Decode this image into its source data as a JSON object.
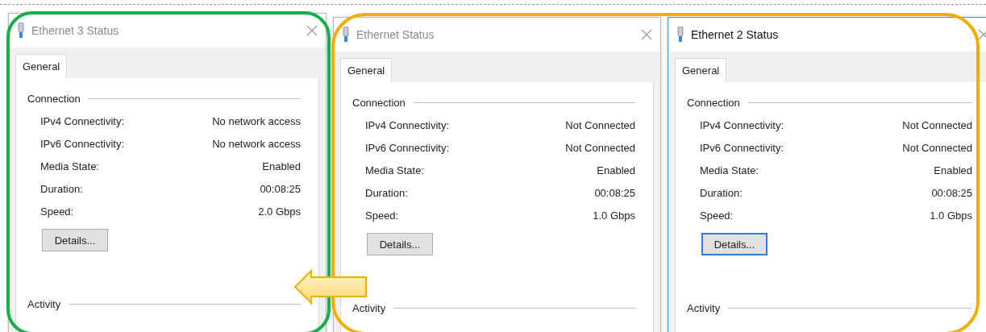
{
  "windows": [
    {
      "title": "Ethernet 3 Status",
      "active": false,
      "tabs": [
        {
          "label": "General",
          "selected": true
        }
      ],
      "section": "Connection",
      "rows": [
        {
          "label": "IPv4 Connectivity:",
          "value": "No network access"
        },
        {
          "label": "IPv6 Connectivity:",
          "value": "No network access"
        },
        {
          "label": "Media State:",
          "value": "Enabled"
        },
        {
          "label": "Duration:",
          "value": "00:08:25"
        },
        {
          "label": "Speed:",
          "value": "2.0 Gbps"
        }
      ],
      "button": {
        "label": "Details...",
        "focused": false
      },
      "next_section": "Activity"
    },
    {
      "title": "Ethernet Status",
      "active": false,
      "tabs": [
        {
          "label": "General",
          "selected": true
        }
      ],
      "section": "Connection",
      "rows": [
        {
          "label": "IPv4 Connectivity:",
          "value": "Not Connected"
        },
        {
          "label": "IPv6 Connectivity:",
          "value": "Not Connected"
        },
        {
          "label": "Media State:",
          "value": "Enabled"
        },
        {
          "label": "Duration:",
          "value": "00:08:25"
        },
        {
          "label": "Speed:",
          "value": "1.0 Gbps"
        }
      ],
      "button": {
        "label": "Details...",
        "focused": false
      },
      "next_section": "Activity"
    },
    {
      "title": "Ethernet 2 Status",
      "active": true,
      "tabs": [
        {
          "label": "General",
          "selected": true
        }
      ],
      "section": "Connection",
      "rows": [
        {
          "label": "IPv4 Connectivity:",
          "value": "Not Connected"
        },
        {
          "label": "IPv6 Connectivity:",
          "value": "Not Connected"
        },
        {
          "label": "Media State:",
          "value": "Enabled"
        },
        {
          "label": "Duration:",
          "value": "00:08:25"
        },
        {
          "label": "Speed:",
          "value": "1.0 Gbps"
        }
      ],
      "button": {
        "label": "Details...",
        "focused": true
      },
      "next_section": "Activity"
    }
  ]
}
